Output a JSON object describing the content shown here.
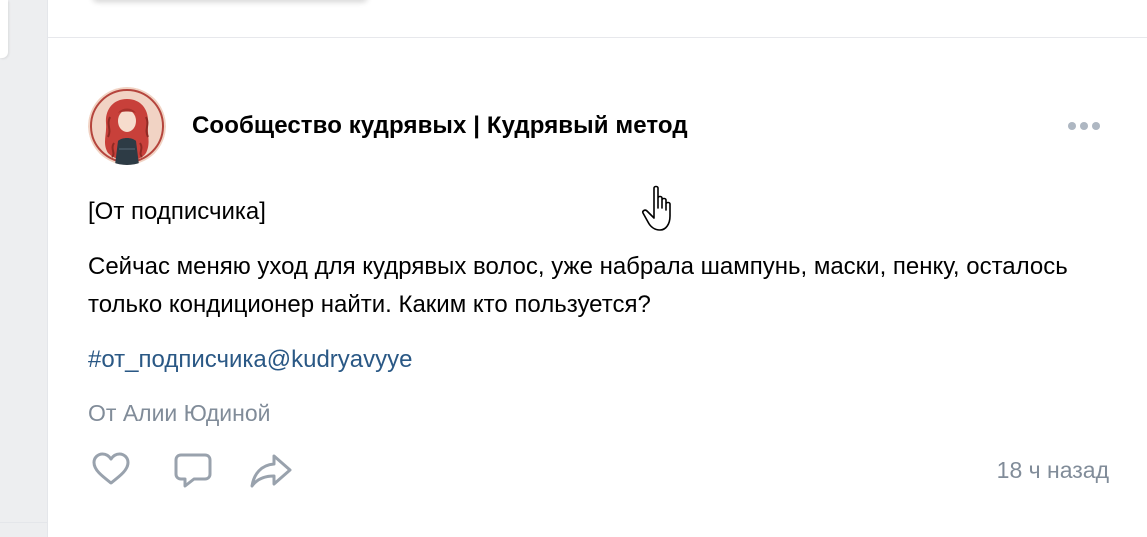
{
  "post": {
    "author": "Сообщество кудрявых | Кудрявый метод",
    "intro": "[От подписчика]",
    "body": "Сейчас меняю уход для кудрявых волос, уже набрала шампунь, маски, пенку, осталось только кондиционер найти. Каким кто пользуется?",
    "hashtag": "#от_подписчика@kudryavyye",
    "signer": "От Алии Юдиной",
    "timestamp": "18 ч назад"
  },
  "icons": {
    "more": "more-dots-icon",
    "like": "heart-icon",
    "comment": "comment-bubble-icon",
    "share": "share-arrow-icon",
    "cursor": "hand-pointer-cursor-icon"
  },
  "colors": {
    "link": "#2a5885",
    "secondary_text": "#818c99",
    "icon_gray": "#aeb7c2",
    "accent_green": "#4bb34b",
    "avatar_bg": "#f1d3c4",
    "avatar_hair": "#c8403a"
  }
}
